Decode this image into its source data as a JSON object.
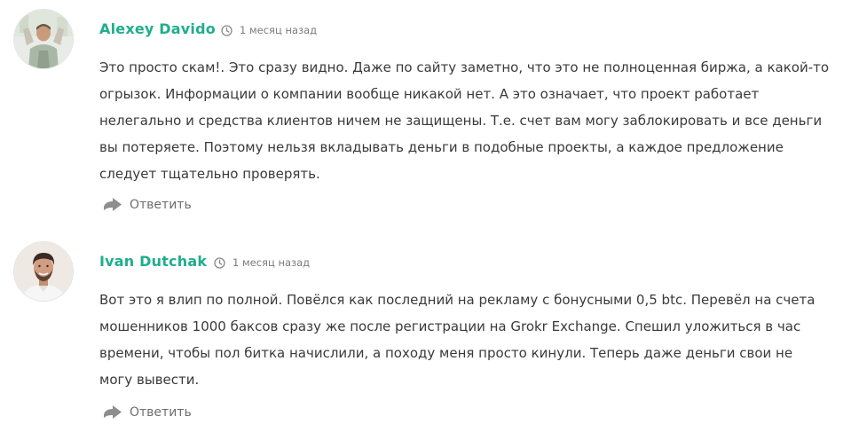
{
  "comments": [
    {
      "author": "Alexey Davido",
      "time": "1 месяц назад",
      "text": "Это просто скам!. Это сразу видно. Даже по сайту заметно, что это не полноценная биржа, а какой-то\nогрызок. Информации о компании вообще никакой нет. А это означает, что проект работает\nнелегально и средства клиентов ничем не защищены. Т.е. счет вам могу заблокировать и все деньги\nвы потеряете. Поэтому нельзя вкладывать деньги в подобные проекты, а каждое предложение\nследует тщательно проверять.",
      "reply_label": "Ответить",
      "avatar_icon": "user-avatar-photo"
    },
    {
      "author": "Ivan Dutchak",
      "time": "1 месяц назад",
      "text": "Вот это я влип по полной. Повёлся как последний на рекламу с бонусными 0,5 btc. Перевёл на счета\nмошенников 1000 баксов сразу же после регистрации на Grokr Exchange. Спешил уложиться в час\nвремени, чтобы пол битка начислили, а походу меня просто кинули. Теперь даже деньги свои не\nмогу вывести.",
      "reply_label": "Ответить",
      "avatar_icon": "user-avatar-photo"
    }
  ],
  "colors": {
    "author": "#1fae8c",
    "text": "#3a3a3a",
    "meta": "#7b7b7b",
    "reply": "#6d6d6d"
  },
  "icons": {
    "time": "clock-icon",
    "reply": "reply-arrow-icon"
  }
}
